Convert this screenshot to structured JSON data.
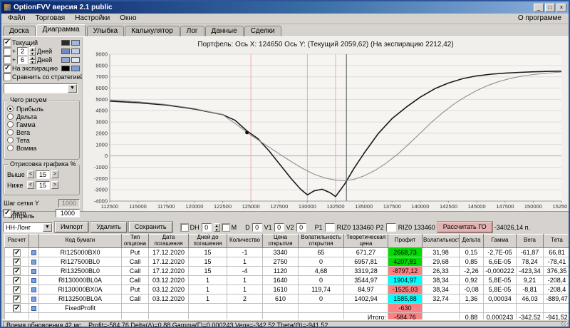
{
  "window": {
    "title": "OptionFVV версия 2.1 public",
    "controls": {
      "minimize": "_",
      "maximize": "□",
      "close": "×"
    }
  },
  "menu": {
    "items": [
      "Файл",
      "Торговая",
      "Настройки",
      "Окно"
    ],
    "right": "О программе"
  },
  "tabs": {
    "items": [
      "Доска",
      "Диаграмма",
      "Улыбка",
      "Калькулятор",
      "Лог",
      "Данные",
      "Сделки"
    ],
    "active": "Диаграмма"
  },
  "left_panel": {
    "series_toggles": [
      {
        "label": "Текущий",
        "checked": true,
        "swatches": [
          "#2b2b2b",
          "#9fb6de"
        ]
      },
      {
        "prefix": "+",
        "value": "2",
        "suffix": "Дней",
        "checked": false,
        "swatches": [
          "#6d8cc9",
          "#c0cfeb"
        ]
      },
      {
        "prefix": "+",
        "value": "6",
        "suffix": "Дней",
        "checked": false,
        "swatches": [
          "#93a9d8",
          "#dfe6f4"
        ]
      },
      {
        "label": "На экспирацию",
        "checked": true,
        "swatches": [
          "#000000",
          "#7f9fd4"
        ]
      },
      {
        "label": "Сравнить со стратегией",
        "checked": false,
        "swatches": []
      }
    ],
    "strategy_combo_value": "",
    "draw_group": {
      "title": "Чего рисуем",
      "options": [
        "Прибыль",
        "Дельта",
        "Гамма",
        "Вега",
        "Тета",
        "Вомма"
      ],
      "selected": "Прибыль"
    },
    "range_group": {
      "title": "Отрисовка графика %",
      "rows": [
        {
          "label": "Выше",
          "value": "15"
        },
        {
          "label": "Ниже",
          "value": "15"
        }
      ]
    },
    "grid_step": {
      "label": "Шаг сетки Y",
      "value": "1000",
      "auto_label": "Авто",
      "auto_checked": true,
      "auto_value": "1000"
    }
  },
  "chart": {
    "title": "Портфель:  Ось X: 124650 Ось Y:  (Текущий 2059,62)  (На экспирацию 2212,42)"
  },
  "chart_data": {
    "type": "line",
    "title": "Портфель:  Ось X: 124650 Ось Y:  (Текущий 2059,62)  (На экспирацию 2212,42)",
    "xlabel": "",
    "ylabel": "",
    "xlim": [
      112500,
      152500
    ],
    "ylim": [
      -4000,
      9000
    ],
    "x_tick_step": 2500,
    "y_tick_step": 1000,
    "grid": true,
    "grid_color": "#dcdcdc",
    "zero_line_color": "#aaaaaa",
    "strike_lines": [
      125000,
      130000,
      132500
    ],
    "strike_color": "#f0a4b8",
    "price_line": 133460,
    "price_line_color": "#555555",
    "marker": {
      "x": 124650,
      "y": 2059.62,
      "color": "#111111"
    },
    "series": [
      {
        "name": "На экспирацию",
        "color": "#1a1a1a",
        "width": 1.6,
        "points": [
          [
            112500,
            4850
          ],
          [
            115000,
            4700
          ],
          [
            117500,
            4500
          ],
          [
            120000,
            4150
          ],
          [
            122500,
            3650
          ],
          [
            123600,
            3150
          ],
          [
            124650,
            2212
          ],
          [
            125600,
            1550
          ],
          [
            126600,
            450
          ],
          [
            127600,
            -800
          ],
          [
            128600,
            -2050
          ],
          [
            129400,
            -2950
          ],
          [
            130000,
            -3450
          ],
          [
            130600,
            -3100
          ],
          [
            131300,
            -2950
          ],
          [
            132000,
            -3250
          ],
          [
            132500,
            -3600
          ],
          [
            133300,
            -2500
          ],
          [
            134100,
            -1150
          ],
          [
            135000,
            200
          ],
          [
            136300,
            2000
          ],
          [
            137500,
            3300
          ],
          [
            138800,
            4350
          ],
          [
            140000,
            5200
          ],
          [
            141300,
            5950
          ],
          [
            142500,
            6450
          ],
          [
            143800,
            6850
          ],
          [
            145000,
            7080
          ],
          [
            146300,
            7230
          ],
          [
            147500,
            7320
          ],
          [
            148800,
            7390
          ],
          [
            150000,
            7440
          ],
          [
            151300,
            7480
          ],
          [
            152500,
            7500
          ]
        ]
      },
      {
        "name": "Текущий",
        "color": "#909090",
        "width": 1.1,
        "points": [
          [
            112500,
            4950
          ],
          [
            115000,
            4790
          ],
          [
            117500,
            4550
          ],
          [
            120000,
            4190
          ],
          [
            122500,
            3640
          ],
          [
            124000,
            2580
          ],
          [
            124650,
            2060
          ],
          [
            125600,
            1440
          ],
          [
            126600,
            780
          ],
          [
            127600,
            120
          ],
          [
            128600,
            -520
          ],
          [
            129600,
            -1120
          ],
          [
            130600,
            -1630
          ],
          [
            131600,
            -1970
          ],
          [
            132600,
            -2160
          ],
          [
            133300,
            -2200
          ],
          [
            134100,
            -2090
          ],
          [
            135000,
            -1780
          ],
          [
            136000,
            -1280
          ],
          [
            137000,
            -630
          ],
          [
            138000,
            150
          ],
          [
            139000,
            1060
          ],
          [
            140000,
            2020
          ],
          [
            141000,
            2980
          ],
          [
            142000,
            3840
          ],
          [
            143000,
            4600
          ],
          [
            144000,
            5240
          ],
          [
            145000,
            5790
          ],
          [
            146000,
            6240
          ],
          [
            147000,
            6590
          ],
          [
            148000,
            6860
          ],
          [
            149000,
            7060
          ],
          [
            150000,
            7200
          ],
          [
            151300,
            7330
          ],
          [
            152500,
            7420
          ]
        ]
      }
    ]
  },
  "portfolio": {
    "section_label": "Портфель",
    "strategy_combo": "НН-Лонг",
    "import_button": "Импорт",
    "delete_button": "Удалить",
    "save_button": "Сохранить",
    "dh_label": "DH",
    "dh_value": "0",
    "m_label": "М",
    "d_label": "D",
    "d_value": "0",
    "v1_label": "V1",
    "v1_value": "0",
    "v2_label": "V2",
    "v2_value": "0",
    "p1_label": "P1",
    "p1_ticker": "RIZ0 133460",
    "p2_label": "P2",
    "p2_ticker": "RIZ0 133460",
    "calc_go_button": "Рассчитать ГО",
    "go_value": "-34026,14 п.",
    "table": {
      "headers": [
        "Расчет",
        "",
        "Код бумаги",
        "Тип опциона",
        "Дата погашения",
        "Дней до погашения",
        "Количество",
        "Цена открытия",
        "Волатильность открытия",
        "Теоретическая цена",
        "Профит",
        "Волатильность",
        "Дельта",
        "Гамма",
        "Вега",
        "Тета"
      ],
      "profit_colors": {
        "green": "#00DC00",
        "red": "#FF8080",
        "cyan": "#00FFFF"
      },
      "rows": [
        {
          "checked": true,
          "code": "RI125000BX0",
          "type": "Put",
          "maturity": "17.12.2020",
          "days": "15",
          "qty": "-1",
          "open_price": "3340",
          "open_vol": "65",
          "theor": "671,27",
          "profit": "2668,73",
          "profit_color": "green",
          "vol": "31,98",
          "delta": "0,15",
          "gamma": "-2,7E-05",
          "vega": "-61,87",
          "theta": "66,81"
        },
        {
          "checked": true,
          "code": "RI127500BL0",
          "type": "Call",
          "maturity": "17.12.2020",
          "days": "15",
          "qty": "1",
          "open_price": "2750",
          "open_vol": "0",
          "theor": "6957,81",
          "profit": "4207,81",
          "profit_color": "green",
          "vol": "29,68",
          "delta": "0,85",
          "gamma": "6,6E-05",
          "vega": "78,24",
          "theta": "-78,41"
        },
        {
          "checked": true,
          "code": "RI132500BL0",
          "type": "Call",
          "maturity": "17.12.2020",
          "days": "15",
          "qty": "-4",
          "open_price": "1120",
          "open_vol": "4,68",
          "theor": "3319,28",
          "profit": "-8797,12",
          "profit_color": "red",
          "vol": "26,33",
          "delta": "-2,26",
          "gamma": "-0,000222",
          "vega": "-423,34",
          "theta": "376,35"
        },
        {
          "checked": true,
          "code": "RI130000BL0A",
          "type": "Call",
          "maturity": "03.12.2020",
          "days": "1",
          "qty": "1",
          "open_price": "1640",
          "open_vol": "0",
          "theor": "3544,97",
          "profit": "1904,97",
          "profit_color": "cyan",
          "vol": "38,34",
          "delta": "0,92",
          "gamma": "5,8E-05",
          "vega": "9,21",
          "theta": "-208,4"
        },
        {
          "checked": true,
          "code": "RI130000BX0A",
          "type": "Put",
          "maturity": "03.12.2020",
          "days": "1",
          "qty": "1",
          "open_price": "1610",
          "open_vol": "119,74",
          "theor": "84,97",
          "profit": "-1525,03",
          "profit_color": "red",
          "vol": "38,34",
          "delta": "-0,08",
          "gamma": "5,8E-05",
          "vega": "-8,81",
          "theta": "-208,4"
        },
        {
          "checked": true,
          "code": "RI132500BL0A",
          "type": "Call",
          "maturity": "03.12.2020",
          "days": "1",
          "qty": "2",
          "open_price": "610",
          "open_vol": "0",
          "theor": "1402,94",
          "profit": "1585,88",
          "profit_color": "cyan",
          "vol": "32,74",
          "delta": "1,36",
          "gamma": "0,00034",
          "vega": "46,03",
          "theta": "-889,47"
        },
        {
          "checked": true,
          "code": "FixedProfit",
          "profit": "-630",
          "profit_color": "red"
        },
        {
          "summary": true,
          "theor": "Итого:",
          "profit": "-584,76",
          "profit_color": "red",
          "delta": "0,88",
          "gamma": "0,000243",
          "vega": "-342,52",
          "theta": "-941,52"
        }
      ]
    }
  },
  "status_bar": {
    "left": "Время обновления 42 мс",
    "metrics": "Profit=-584,76 Delta(Δ)=0,88 Gamma(Γ)=0,000243 Vega=-342,52 Theta(Θ)=-941,52"
  }
}
